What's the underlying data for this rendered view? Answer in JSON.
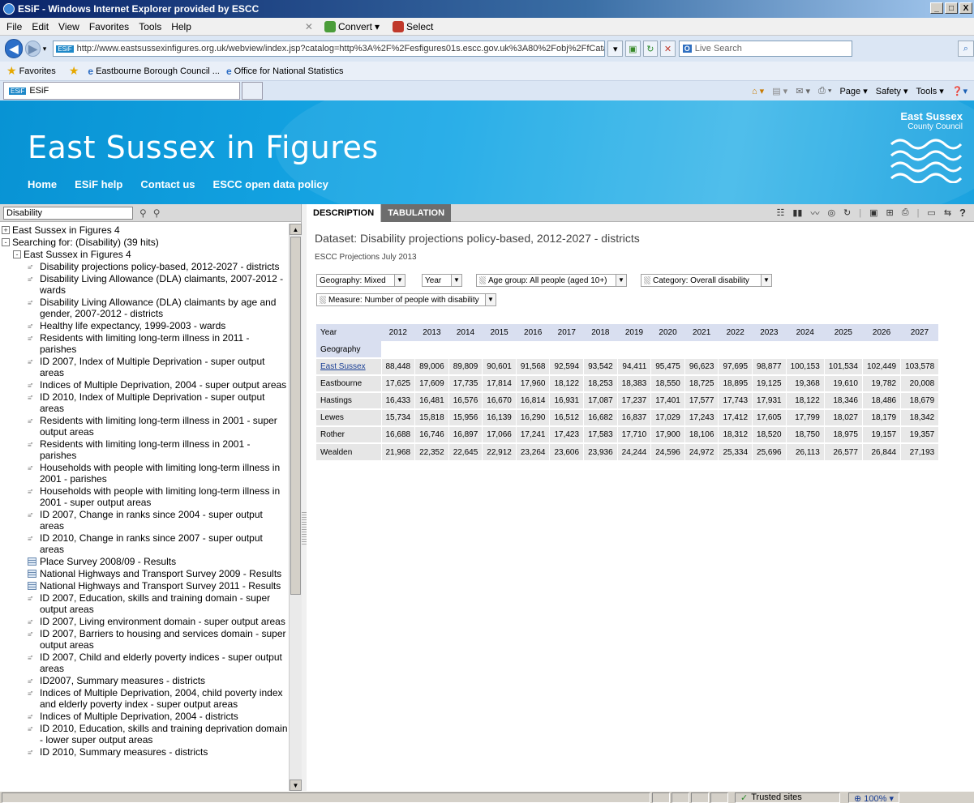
{
  "window": {
    "title": "ESiF - Windows Internet Explorer provided by ESCC",
    "controls": [
      "_",
      "□",
      "X"
    ]
  },
  "menu": {
    "items": [
      "File",
      "Edit",
      "View",
      "Favorites",
      "Tools",
      "Help"
    ],
    "convert_label": "Convert",
    "select_label": "Select"
  },
  "address": {
    "favicon": "ESiF",
    "url": "http://www.eastsussexinfigures.org.uk/webview/index.jsp?catalog=http%3A%2F%2Fesfigures01s.escc.gov.uk%3A80%2Fobj%2FfCatalog%2FCatalog47&submode=",
    "search_placeholder": "Live Search"
  },
  "favorites": {
    "label": "Favorites",
    "links": [
      "Eastbourne Borough Council ...",
      "Office for National Statistics"
    ]
  },
  "tabs": {
    "current": "ESiF",
    "commands": [
      "Page ▾",
      "Safety ▾",
      "Tools ▾"
    ]
  },
  "site": {
    "title": "East Sussex in Figures",
    "nav": [
      "Home",
      "ESiF help",
      "Contact us",
      "ESCC open data policy"
    ],
    "logo_line1": "East Sussex",
    "logo_line2": "County Council",
    "colors": {
      "header": "#0a9ad8",
      "link": "#1a3f95",
      "tab_inactive": "#6d6d6d"
    }
  },
  "left": {
    "search_value": "Disability",
    "tree": [
      {
        "level": 1,
        "toggle": "+",
        "label": "East Sussex in Figures 4"
      },
      {
        "level": 1,
        "toggle": "-",
        "label": "Searching for: (Disability) (39 hits)"
      },
      {
        "level": 2,
        "toggle": "-",
        "label": "East Sussex in Figures 4"
      },
      {
        "level": 3,
        "icon": "dataset",
        "label": "Disability projections policy-based, 2012-2027 - districts"
      },
      {
        "level": 3,
        "icon": "dataset",
        "label": "Disability Living Allowance (DLA) claimants, 2007-2012 - wards"
      },
      {
        "level": 3,
        "icon": "dataset",
        "label": "Disability Living Allowance (DLA) claimants by age and gender, 2007-2012 - districts"
      },
      {
        "level": 3,
        "icon": "dataset",
        "label": "Healthy life expectancy, 1999-2003 - wards"
      },
      {
        "level": 3,
        "icon": "dataset",
        "label": "Residents with limiting long-term illness in 2011 - parishes"
      },
      {
        "level": 3,
        "icon": "dataset",
        "label": "ID 2007, Index of Multiple Deprivation - super output areas"
      },
      {
        "level": 3,
        "icon": "dataset",
        "label": "Indices of Multiple Deprivation, 2004 - super output areas"
      },
      {
        "level": 3,
        "icon": "dataset",
        "label": "ID 2010, Index of Multiple Deprivation - super output areas"
      },
      {
        "level": 3,
        "icon": "dataset",
        "label": "Residents with limiting long-term illness in 2001 - super output areas"
      },
      {
        "level": 3,
        "icon": "dataset",
        "label": "Residents with limiting long-term illness in 2001 - parishes"
      },
      {
        "level": 3,
        "icon": "dataset",
        "label": "Households with people with limiting long-term illness in 2001 - parishes"
      },
      {
        "level": 3,
        "icon": "dataset",
        "label": "Households with people with limiting long-term illness in 2001 - super output areas"
      },
      {
        "level": 3,
        "icon": "dataset",
        "label": "ID 2007, Change in ranks since 2004 - super output areas"
      },
      {
        "level": 3,
        "icon": "dataset",
        "label": "ID 2010, Change in ranks since 2007 - super output areas"
      },
      {
        "level": 3,
        "icon": "table",
        "label": "Place Survey 2008/09 - Results"
      },
      {
        "level": 3,
        "icon": "table",
        "label": "National Highways and Transport Survey 2009 - Results"
      },
      {
        "level": 3,
        "icon": "table",
        "label": "National Highways and Transport Survey 2011 - Results"
      },
      {
        "level": 3,
        "icon": "dataset",
        "label": "ID 2007, Education, skills and training domain - super output areas"
      },
      {
        "level": 3,
        "icon": "dataset",
        "label": "ID 2007, Living environment domain - super output areas"
      },
      {
        "level": 3,
        "icon": "dataset",
        "label": "ID 2007, Barriers to housing and services domain - super output areas"
      },
      {
        "level": 3,
        "icon": "dataset",
        "label": "ID 2007, Child and elderly poverty indices - super output areas"
      },
      {
        "level": 3,
        "icon": "dataset",
        "label": "ID2007, Summary measures - districts"
      },
      {
        "level": 3,
        "icon": "dataset",
        "label": "Indices of Multiple Deprivation, 2004, child poverty index and elderly poverty index - super output areas"
      },
      {
        "level": 3,
        "icon": "dataset",
        "label": "Indices of Multiple Deprivation, 2004 - districts"
      },
      {
        "level": 3,
        "icon": "dataset",
        "label": "ID 2010, Education, skills and training deprivation domain - lower super output areas"
      },
      {
        "level": 3,
        "icon": "dataset",
        "label": "ID 2010, Summary measures - districts"
      }
    ]
  },
  "right": {
    "tabs": [
      "DESCRIPTION",
      "TABULATION"
    ],
    "dataset_title": "Dataset: Disability projections policy-based, 2012-2027 - districts",
    "source": "ESCC Projections July 2013",
    "filters": {
      "geography": "Geography: Mixed",
      "year": "Year",
      "age": "Age group: All people (aged 10+)",
      "category": "Category: Overall disability",
      "measure": "Measure: Number of people with disability"
    },
    "table": {
      "year_label": "Year",
      "geo_label": "Geography",
      "years": [
        "2012",
        "2013",
        "2014",
        "2015",
        "2016",
        "2017",
        "2018",
        "2019",
        "2020",
        "2021",
        "2022",
        "2023",
        "2024",
        "2025",
        "2026",
        "2027"
      ],
      "rows": [
        {
          "name": "East Sussex",
          "link": true,
          "values": [
            "88,448",
            "89,006",
            "89,809",
            "90,601",
            "91,568",
            "92,594",
            "93,542",
            "94,411",
            "95,475",
            "96,623",
            "97,695",
            "98,877",
            "100,153",
            "101,534",
            "102,449",
            "103,578"
          ]
        },
        {
          "name": "Eastbourne",
          "values": [
            "17,625",
            "17,609",
            "17,735",
            "17,814",
            "17,960",
            "18,122",
            "18,253",
            "18,383",
            "18,550",
            "18,725",
            "18,895",
            "19,125",
            "19,368",
            "19,610",
            "19,782",
            "20,008"
          ]
        },
        {
          "name": "Hastings",
          "values": [
            "16,433",
            "16,481",
            "16,576",
            "16,670",
            "16,814",
            "16,931",
            "17,087",
            "17,237",
            "17,401",
            "17,577",
            "17,743",
            "17,931",
            "18,122",
            "18,346",
            "18,486",
            "18,679"
          ]
        },
        {
          "name": "Lewes",
          "values": [
            "15,734",
            "15,818",
            "15,956",
            "16,139",
            "16,290",
            "16,512",
            "16,682",
            "16,837",
            "17,029",
            "17,243",
            "17,412",
            "17,605",
            "17,799",
            "18,027",
            "18,179",
            "18,342"
          ]
        },
        {
          "name": "Rother",
          "values": [
            "16,688",
            "16,746",
            "16,897",
            "17,066",
            "17,241",
            "17,423",
            "17,583",
            "17,710",
            "17,900",
            "18,106",
            "18,312",
            "18,520",
            "18,750",
            "18,975",
            "19,157",
            "19,357"
          ]
        },
        {
          "name": "Wealden",
          "values": [
            "21,968",
            "22,352",
            "22,645",
            "22,912",
            "23,264",
            "23,606",
            "23,936",
            "24,244",
            "24,596",
            "24,972",
            "25,334",
            "25,696",
            "26,113",
            "26,577",
            "26,844",
            "27,193"
          ]
        }
      ]
    }
  },
  "status": {
    "zone": "Trusted sites",
    "zoom": "100%"
  }
}
